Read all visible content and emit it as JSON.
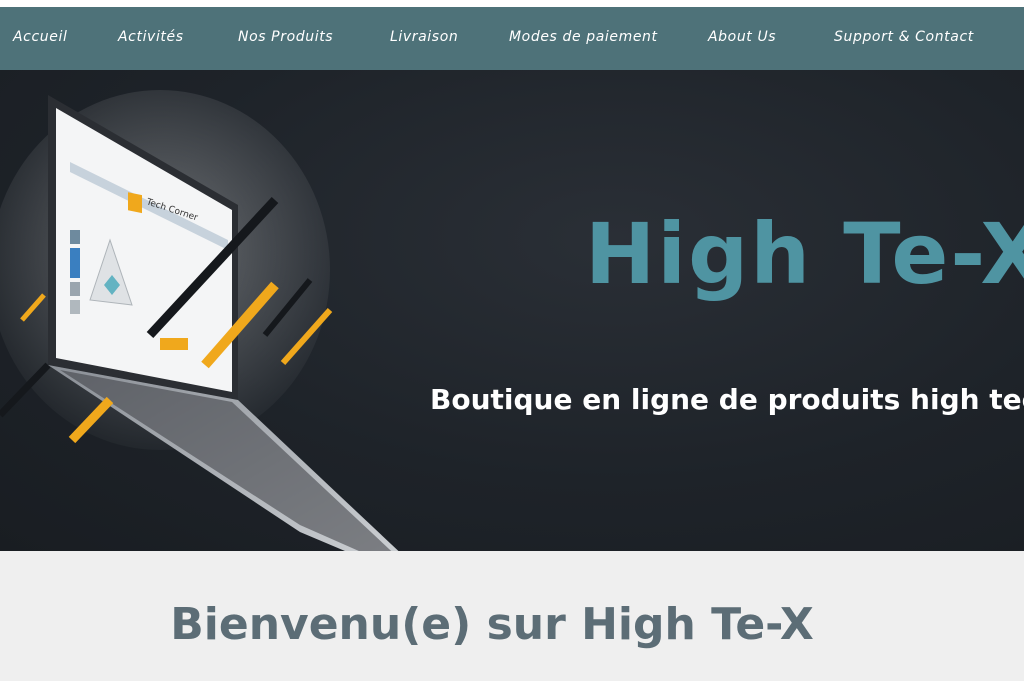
{
  "nav": {
    "items": [
      {
        "label": "Accueil"
      },
      {
        "label": "Activités"
      },
      {
        "label": "Nos Produits"
      },
      {
        "label": "Livraison"
      },
      {
        "label": "Modes de paiement"
      },
      {
        "label": "About Us"
      },
      {
        "label": "Support & Contact"
      }
    ]
  },
  "hero": {
    "title": "High Te-X",
    "subtitle": "Boutique en ligne de produits high tech",
    "laptop_screen": {
      "brand": "Tech Corner"
    }
  },
  "welcome": {
    "heading": "Bienvenu(e) sur High Te-X"
  },
  "colors": {
    "nav_bg": "#4e7279",
    "hero_bg": "#1e2329",
    "accent_teal": "#4f94a2",
    "accent_orange": "#f0a81c",
    "welcome_text": "#5c6d76"
  }
}
